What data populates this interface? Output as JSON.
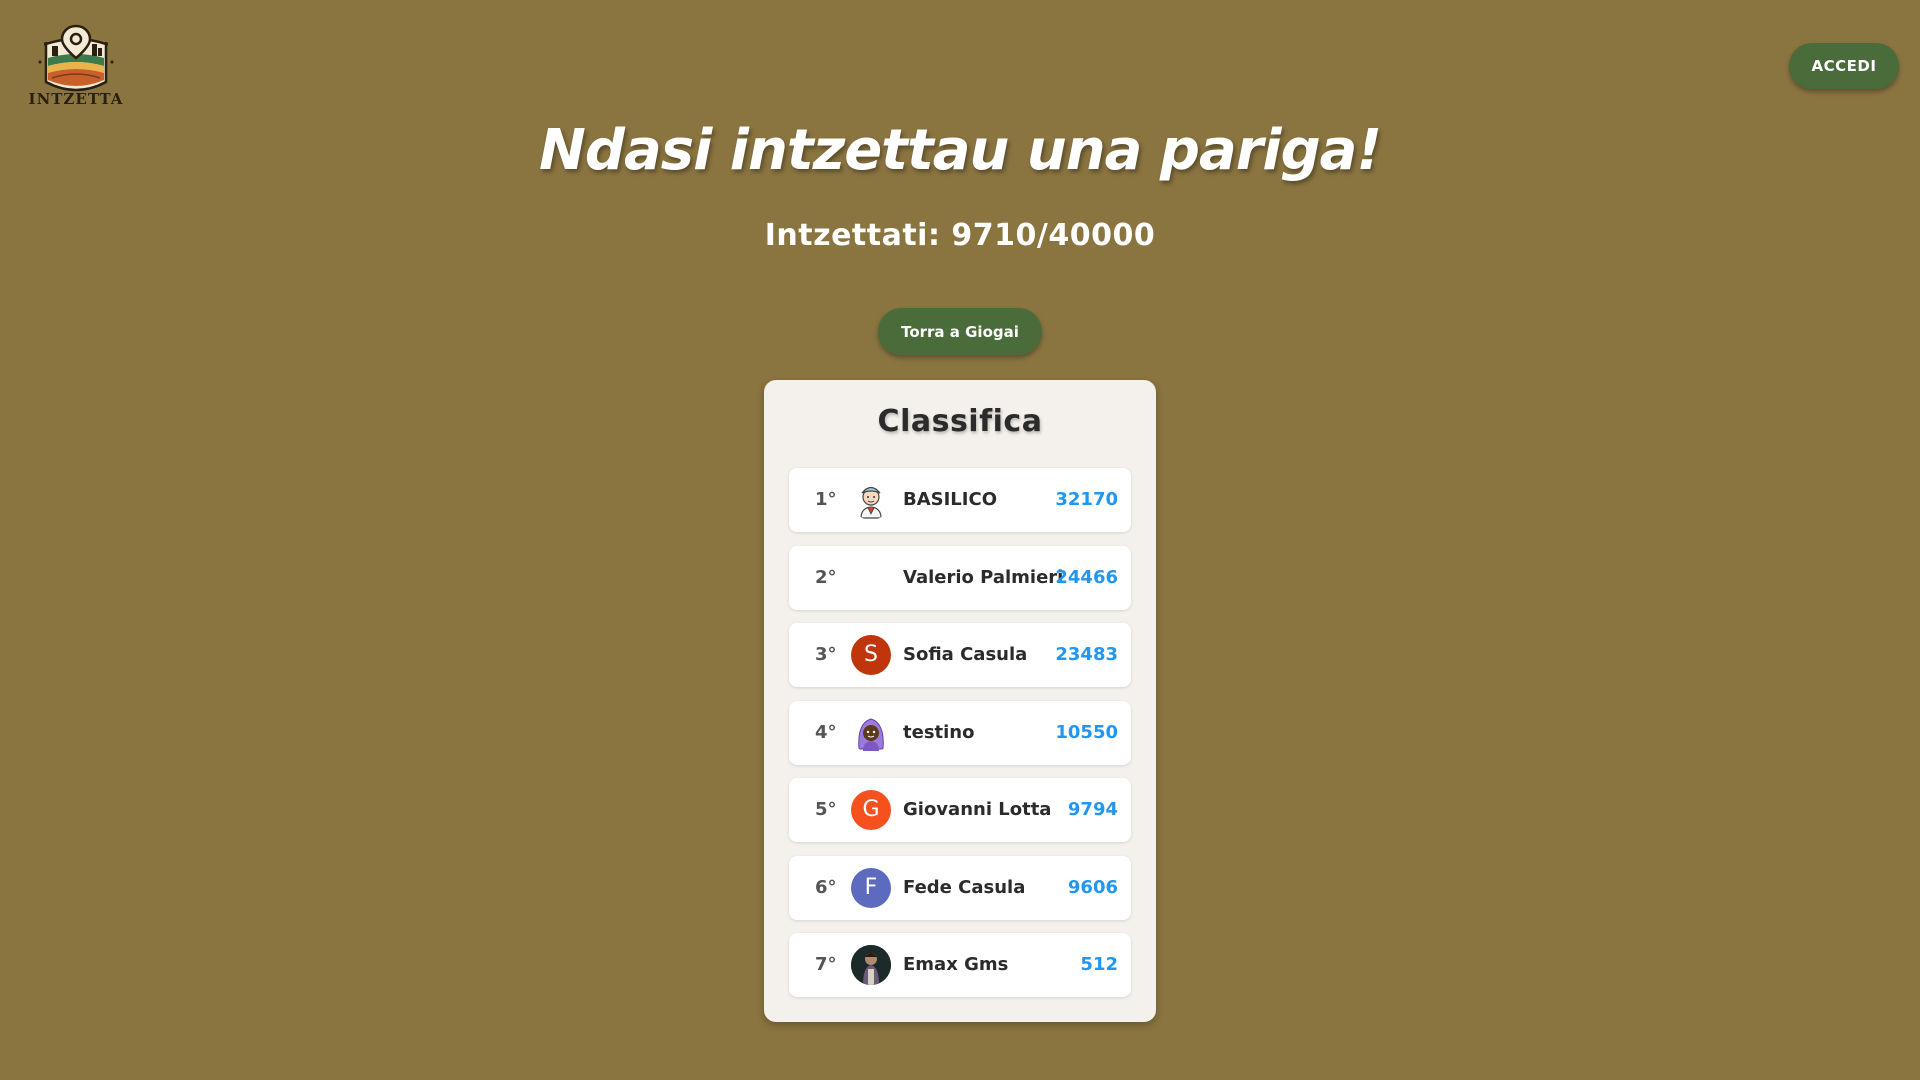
{
  "header": {
    "logo_text": "INTZETTA",
    "login_label": "ACCEDI"
  },
  "main": {
    "headline": "Ndasi intzettau una pariga!",
    "progress": "Intzettati: 9710/40000",
    "play_again_label": "Torra a Giogai"
  },
  "leaderboard": {
    "title": "Classifica",
    "entries": [
      {
        "rank": "1°",
        "name": "BASILICO",
        "score": "32170",
        "avatar": "cartoon-man-icon"
      },
      {
        "rank": "2°",
        "name": "Valerio Palmieri",
        "score": "24466",
        "avatar": "none"
      },
      {
        "rank": "3°",
        "name": "Sofia Casula",
        "score": "23483",
        "avatar": "letter",
        "letter": "S",
        "color": "#bf360c"
      },
      {
        "rank": "4°",
        "name": "testino",
        "score": "10550",
        "avatar": "cartoon-woman-icon"
      },
      {
        "rank": "5°",
        "name": "Giovanni Lotta",
        "score": "9794",
        "avatar": "letter",
        "letter": "G",
        "color": "#f4511e"
      },
      {
        "rank": "6°",
        "name": "Fede Casula",
        "score": "9606",
        "avatar": "letter",
        "letter": "F",
        "color": "#5c6bc0"
      },
      {
        "rank": "7°",
        "name": "Emax Gms",
        "score": "512",
        "avatar": "photo-icon"
      }
    ]
  },
  "colors": {
    "background": "#8a7440",
    "button": "#4a6b3a",
    "card": "#f4f1ec",
    "score": "#2196f3"
  }
}
